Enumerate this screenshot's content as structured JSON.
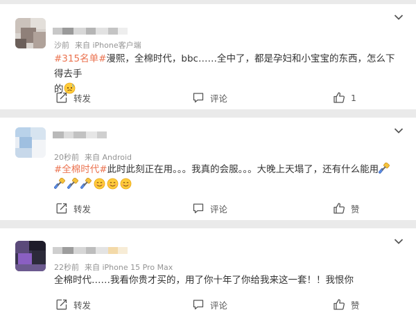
{
  "posts": [
    {
      "meta_time": "沙前",
      "meta_source": "来自 iPhone客户端",
      "tag": "#315名单#",
      "text_line1": "漫熙，全棉时代，bbc……全中了，都是孕妇和小宝宝的东西，怎么下得去手",
      "text_line2": "的",
      "repost_label": "转发",
      "comment_label": "评论",
      "like_label": "1"
    },
    {
      "meta_time": "20秒前",
      "meta_source": "来自 Android",
      "tag": "#全棉时代#",
      "text_line1": "此时此刻正在用。。。我真的会服。。。大晚上天塌了，还有什么能用",
      "repost_label": "转发",
      "comment_label": "评论",
      "like_label": "赞"
    },
    {
      "meta_time": "22秒前",
      "meta_source": "来自 iPhone 15 Pro Max",
      "text_line1": "全棉时代……我看你贵才买的，用了你十年了你给我来这一套！！我恨你",
      "repost_label": "转发",
      "comment_label": "评论",
      "like_label": "赞"
    }
  ],
  "icons": {
    "menu": "chevron-down-icon",
    "repost": "repost-icon",
    "comment": "comment-icon",
    "like": "thumbs-up-icon",
    "emoji_cold": "cold-sweat-emoji",
    "emoji_rocket": "hammer-emoji",
    "emoji_smile": "awkward-smile-emoji"
  },
  "colors": {
    "tag": "#eb7350",
    "meta": "#939393",
    "background": "#eaeaea"
  }
}
